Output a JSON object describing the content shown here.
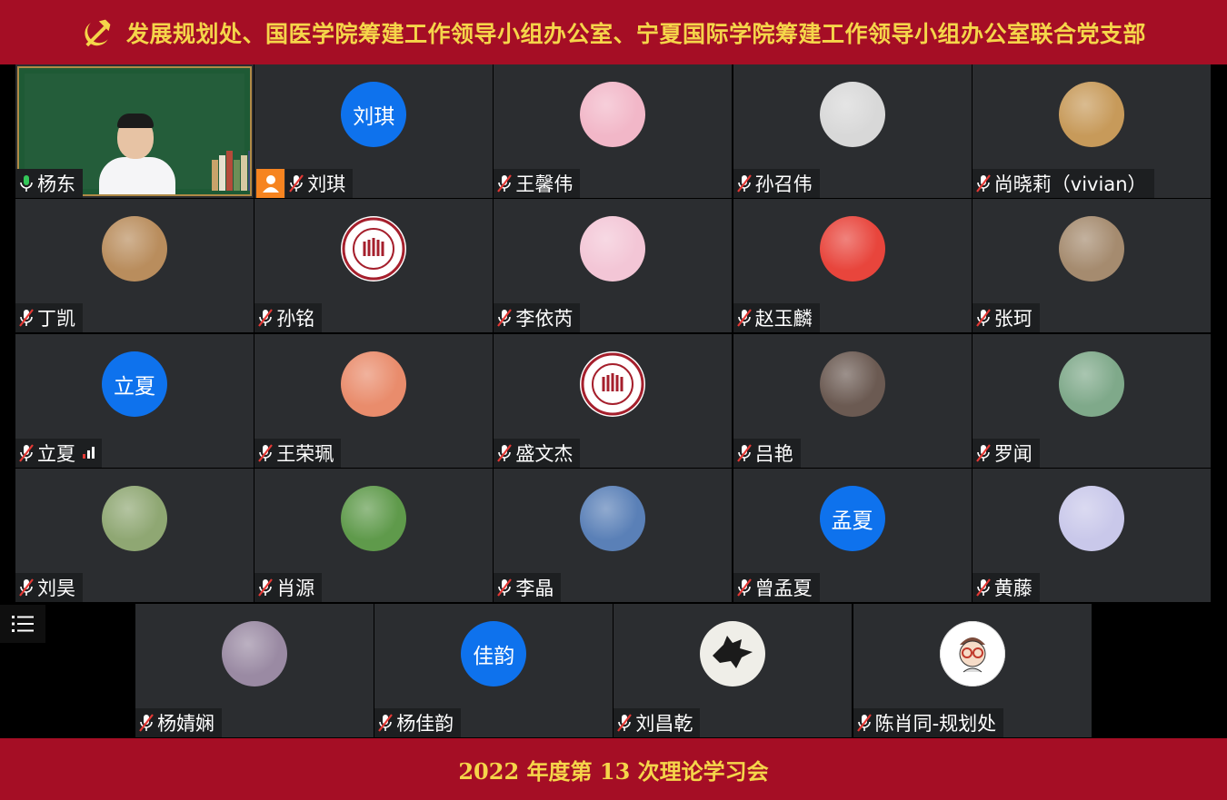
{
  "header": {
    "title": "发展规划处、国医学院筹建工作领导小组办公室、宁夏国际学院筹建工作领导小组办公室联合党支部"
  },
  "footer": {
    "subtitle": "2022 年度第 13 次理论学习会"
  },
  "participants": [
    {
      "name": "杨东",
      "avatar_initial": "",
      "mic": "on",
      "type": "video"
    },
    {
      "name": "刘琪",
      "avatar_initial": "刘琪",
      "mic": "muted",
      "type": "initial"
    },
    {
      "name": "王馨伟",
      "avatar_initial": "",
      "mic": "muted",
      "type": "photo",
      "color": "#f2b7c8"
    },
    {
      "name": "孙召伟",
      "avatar_initial": "",
      "mic": "muted",
      "type": "photo",
      "color": "#d8d8d8"
    },
    {
      "name": "尚晓莉（vivian）",
      "avatar_initial": "",
      "mic": "muted",
      "type": "photo",
      "color": "#c79a5a"
    },
    {
      "name": "丁凯",
      "avatar_initial": "",
      "mic": "muted",
      "type": "photo",
      "color": "#b98d5d"
    },
    {
      "name": "孙铭",
      "avatar_initial": "",
      "mic": "muted",
      "type": "seal",
      "color": "#ffffff"
    },
    {
      "name": "李依芮",
      "avatar_initial": "",
      "mic": "muted",
      "type": "photo",
      "color": "#f3c6d6"
    },
    {
      "name": "赵玉麟",
      "avatar_initial": "",
      "mic": "muted",
      "type": "photo",
      "color": "#e8453c"
    },
    {
      "name": "张珂",
      "avatar_initial": "",
      "mic": "muted",
      "type": "photo",
      "color": "#a58b6f"
    },
    {
      "name": "立夏",
      "avatar_initial": "立夏",
      "mic": "muted",
      "type": "initial",
      "signal": true
    },
    {
      "name": "王荣珮",
      "avatar_initial": "",
      "mic": "muted",
      "type": "photo",
      "color": "#e98c6c"
    },
    {
      "name": "盛文杰",
      "avatar_initial": "",
      "mic": "muted",
      "type": "seal",
      "color": "#ffffff"
    },
    {
      "name": "吕艳",
      "avatar_initial": "",
      "mic": "muted",
      "type": "photo",
      "color": "#6b5a52"
    },
    {
      "name": "罗闻",
      "avatar_initial": "",
      "mic": "muted",
      "type": "photo",
      "color": "#7fa98a"
    },
    {
      "name": "刘昊",
      "avatar_initial": "",
      "mic": "muted",
      "type": "photo",
      "color": "#8fa773"
    },
    {
      "name": "肖源",
      "avatar_initial": "",
      "mic": "muted",
      "type": "photo",
      "color": "#5f9a4b"
    },
    {
      "name": "李晶",
      "avatar_initial": "",
      "mic": "muted",
      "type": "photo",
      "color": "#5a80b7"
    },
    {
      "name": "曾孟夏",
      "avatar_initial": "孟夏",
      "mic": "muted",
      "type": "initial"
    },
    {
      "name": "黄藤",
      "avatar_initial": "",
      "mic": "muted",
      "type": "photo",
      "color": "#c9c8ea"
    },
    {
      "name": "杨婧娴",
      "avatar_initial": "",
      "mic": "muted",
      "type": "photo",
      "color": "#9a8aa3"
    },
    {
      "name": "杨佳韵",
      "avatar_initial": "佳韵",
      "mic": "muted",
      "type": "initial"
    },
    {
      "name": "刘昌乾",
      "avatar_initial": "",
      "mic": "muted",
      "type": "wolf",
      "color": "#efeee8"
    },
    {
      "name": "陈肖同-规划处",
      "avatar_initial": "",
      "mic": "muted",
      "type": "cartoon",
      "color": "#ffffff"
    }
  ],
  "colors": {
    "banner": "#a50e25",
    "banner_text": "#f5d54a",
    "tile": "#2b2d30",
    "initial_bg": "#0e72ed",
    "mic_on": "#34c759"
  },
  "icons": {
    "menu": "menu-list-icon",
    "mic_muted": "mic-muted-icon",
    "mic_on": "mic-on-icon",
    "party": "party-emblem-icon"
  }
}
